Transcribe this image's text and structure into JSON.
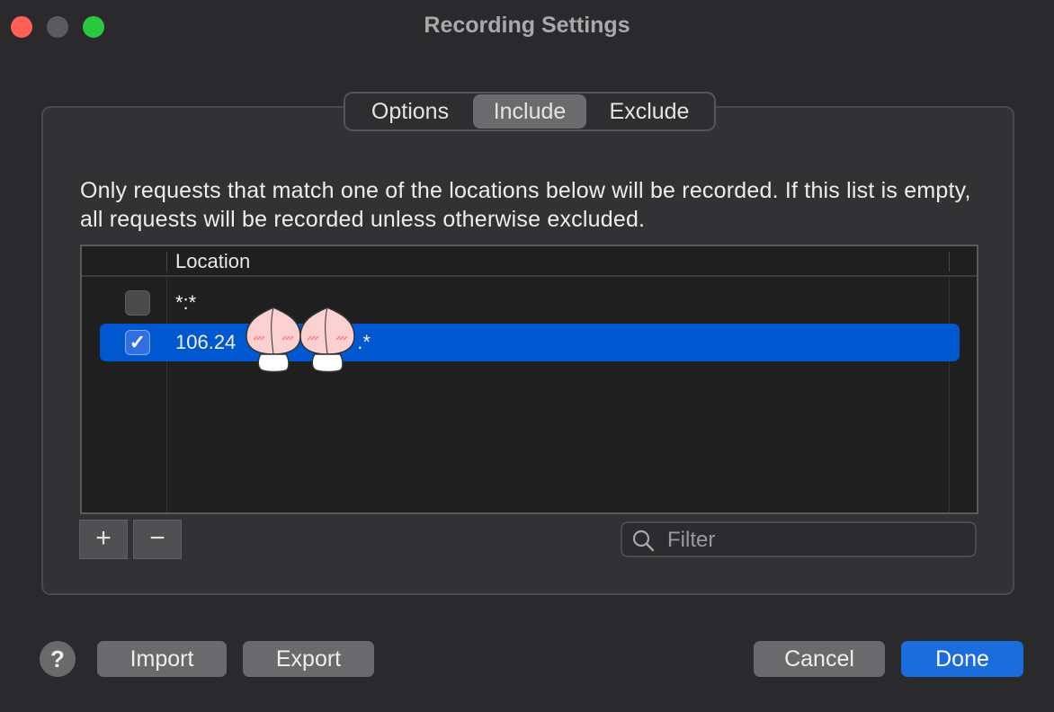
{
  "window": {
    "title": "Recording Settings"
  },
  "tabs": [
    {
      "label": "Options",
      "selected": false
    },
    {
      "label": "Include",
      "selected": true
    },
    {
      "label": "Exclude",
      "selected": false
    }
  ],
  "description": "Only requests that match one of the locations below will be recorded. If this list is empty, all requests will be recorded unless otherwise excluded.",
  "table": {
    "header": "Location",
    "rows": [
      {
        "checked": false,
        "location": "*:*",
        "selected": false
      },
      {
        "checked": true,
        "location": "106.24",
        "location_suffix": ".*",
        "selected": true
      }
    ]
  },
  "list_controls": {
    "add": "+",
    "remove": "−"
  },
  "filter": {
    "placeholder": "Filter",
    "value": ""
  },
  "footer": {
    "help": "?",
    "import": "Import",
    "export": "Export",
    "cancel": "Cancel",
    "done": "Done"
  },
  "colors": {
    "accent": "#0058d0",
    "done_button": "#1b6cdd",
    "close": "#fe5f57",
    "zoom": "#28c840"
  }
}
